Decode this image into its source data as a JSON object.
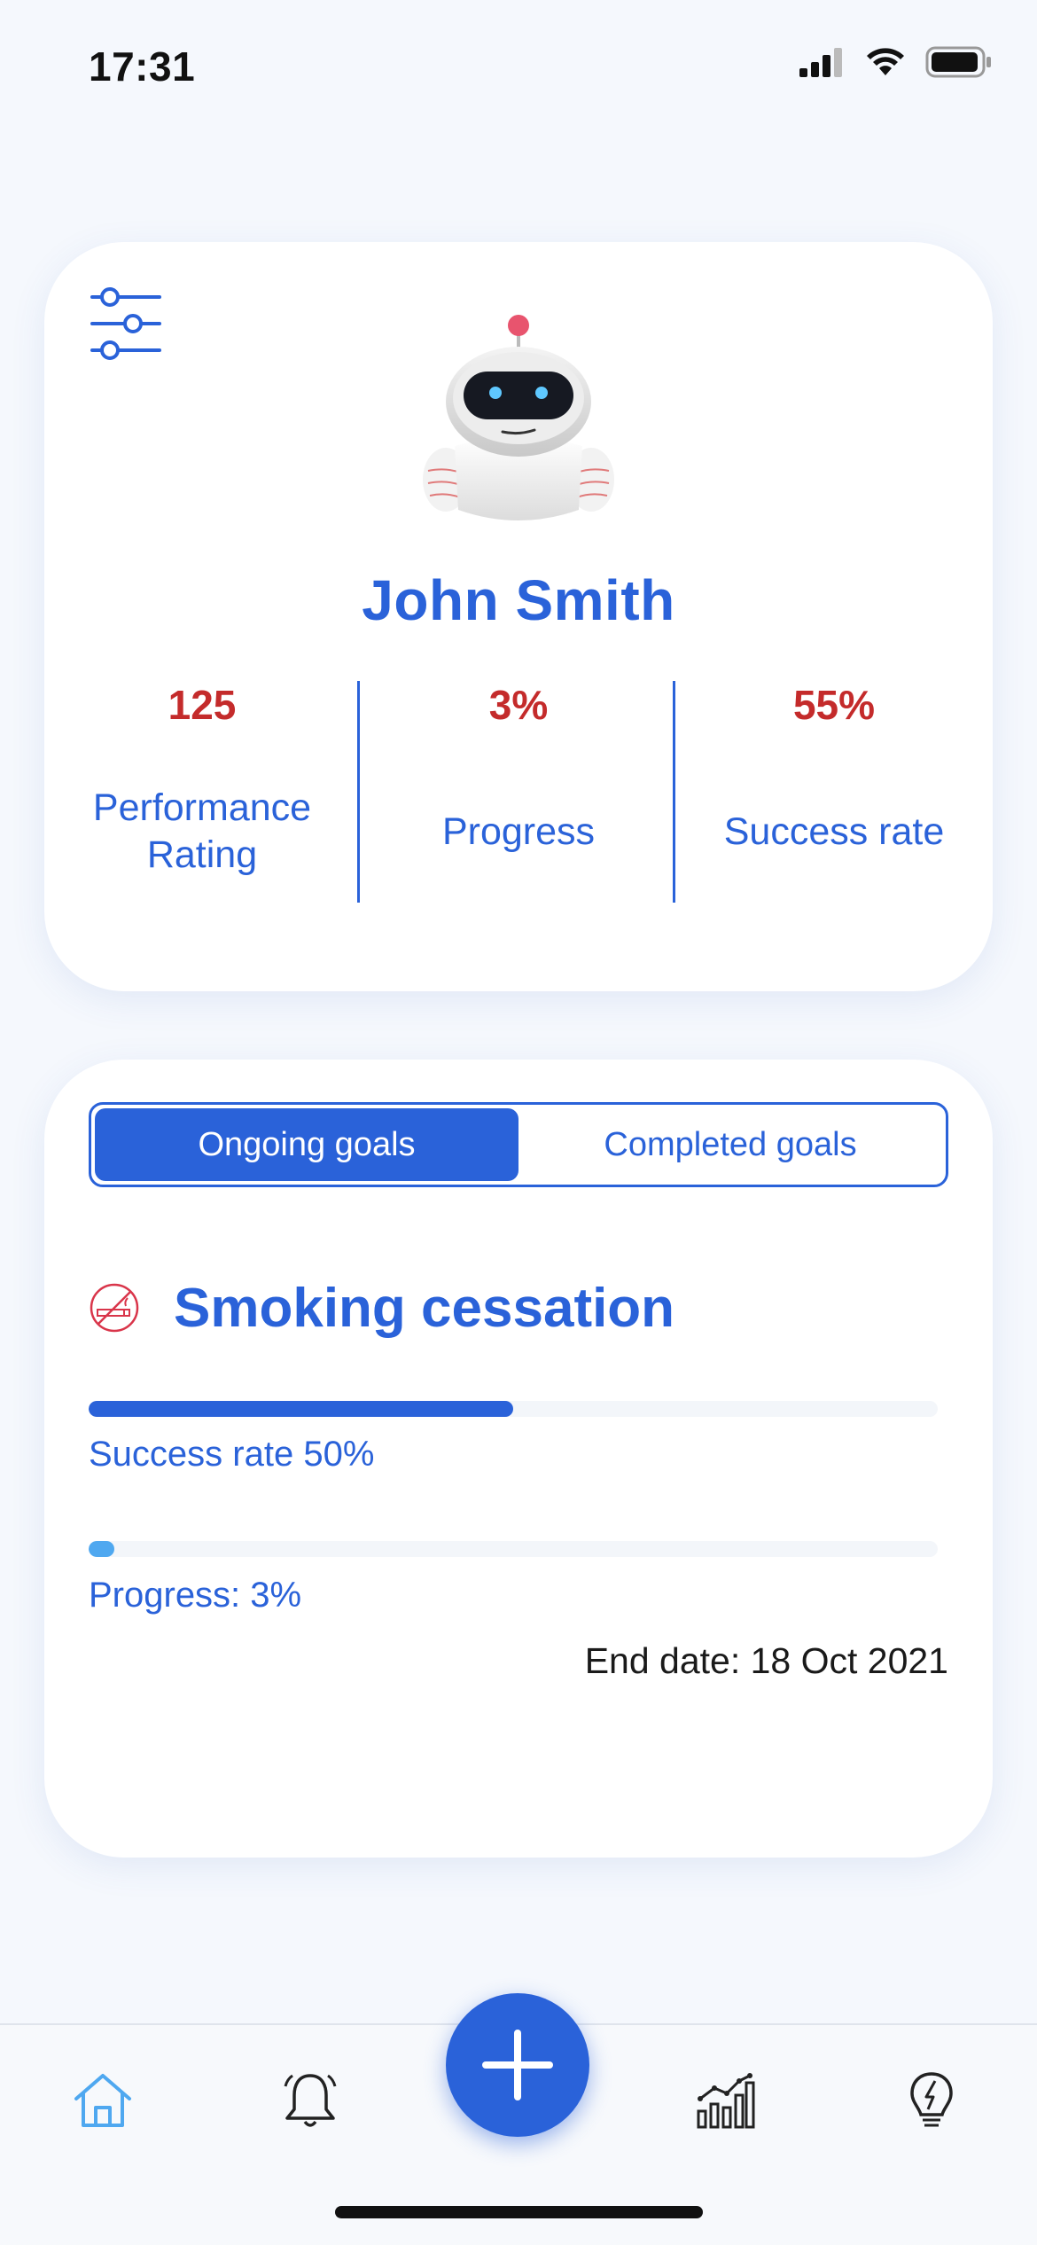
{
  "status_bar": {
    "time": "17:31"
  },
  "profile": {
    "name": "John Smith",
    "stats": [
      {
        "value": "125",
        "label": "Performance Rating"
      },
      {
        "value": "3%",
        "label": "Progress"
      },
      {
        "value": "55%",
        "label": "Success rate"
      }
    ]
  },
  "goals": {
    "tabs": [
      {
        "label": "Ongoing goals",
        "active": true
      },
      {
        "label": "Completed goals",
        "active": false
      }
    ],
    "current_goal": {
      "title": "Smoking cessation",
      "icon": "no-smoking-icon",
      "success_rate": 0.5,
      "success_rate_label": "Success rate 50%",
      "progress": 0.03,
      "progress_label": "Progress: 3%",
      "end_date_label": "End date: 18 Oct 2021"
    }
  },
  "bottom_nav": {
    "items": [
      {
        "icon": "home-icon",
        "active": true
      },
      {
        "icon": "bell-icon",
        "active": false
      },
      {
        "icon": "plus-icon",
        "active": false
      },
      {
        "icon": "chart-icon",
        "active": false
      },
      {
        "icon": "lightbulb-icon",
        "active": false
      }
    ]
  },
  "colors": {
    "primary": "#2a62d9",
    "stat_value": "#c42b2b",
    "progress_light": "#4fa8f0",
    "nav_active": "#4fa8f0",
    "background": "#f5f8fd"
  }
}
